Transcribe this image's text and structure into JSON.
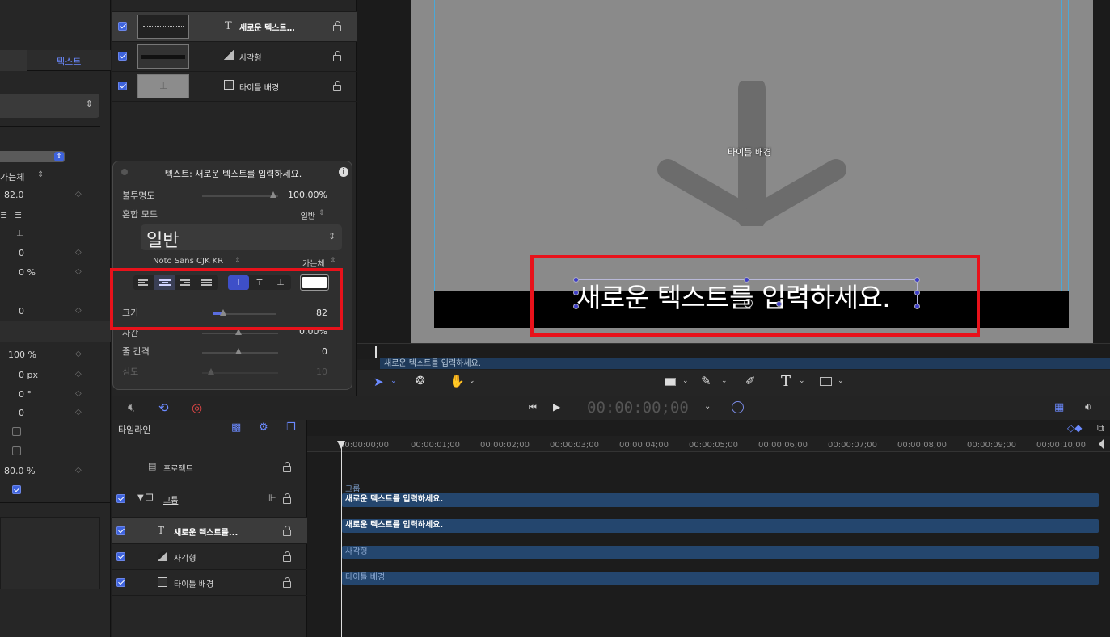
{
  "left_panel": {
    "tab_text": "텍스트",
    "weight_label": "가는체",
    "size_value": "82.0",
    "values": [
      "0",
      "0 %",
      "0",
      "100 %",
      "0 px",
      "0 °",
      "0",
      "80.0 %"
    ]
  },
  "layers": {
    "items": [
      {
        "label": "새로운 텍스트…",
        "icon": "text-icon"
      },
      {
        "label": "사각형",
        "icon": "shape-icon"
      },
      {
        "label": "타이틀 배경",
        "icon": "drop-zone-icon"
      }
    ]
  },
  "hud": {
    "title": "텍스트: 새로운 텍스트를 입력하세요.",
    "opacity_label": "불투명도",
    "opacity_value": "100.00%",
    "opacity_fraction": 1.0,
    "blend_label": "혼합 모드",
    "blend_value": "일반",
    "preset_value": "일반",
    "font_family": "Noto Sans CJK KR",
    "font_weight": "가는체",
    "size_label": "크기",
    "size_value": "82",
    "tracking_label": "자간",
    "tracking_value": "0.00%",
    "line_spacing_label": "줄 간격",
    "line_spacing_value": "0",
    "depth_label": "심도",
    "depth_value": "10",
    "text_color": "#ffffff"
  },
  "canvas": {
    "drop_zone_label": "타이틀 배경",
    "text": "새로운 텍스트를 입력하세요."
  },
  "mini_timeline": {
    "clip_label": "새로운 텍스트를 입력하세요."
  },
  "transport": {
    "timecode": "00:00:00;00"
  },
  "timeline": {
    "title": "타임라인",
    "rows": [
      {
        "label": "프로젝트"
      },
      {
        "label": "그룹"
      },
      {
        "label": "새로운 텍스트를..."
      },
      {
        "label": "사각형"
      },
      {
        "label": "타이틀 배경"
      }
    ],
    "ruler": [
      "00:00:00;00",
      "00:00:01;00",
      "00:00:02;00",
      "00:00:03;00",
      "00:00:04;00",
      "00:00:05;00",
      "00:00:06;00",
      "00:00:07;00",
      "00:00:08;00",
      "00:00:09;00",
      "00:00:10;00"
    ],
    "tracks": {
      "group_label": "그룹",
      "group_text": "새로운 텍스트를 입력하세요.",
      "text_clip": "새로운 텍스트를 입력하세요.",
      "shape_clip": "사각형",
      "bg_clip": "타이틀 배경"
    }
  },
  "colors": {
    "accent": "#3e63dd",
    "highlight": "#e8121b",
    "track": "#24466e"
  }
}
